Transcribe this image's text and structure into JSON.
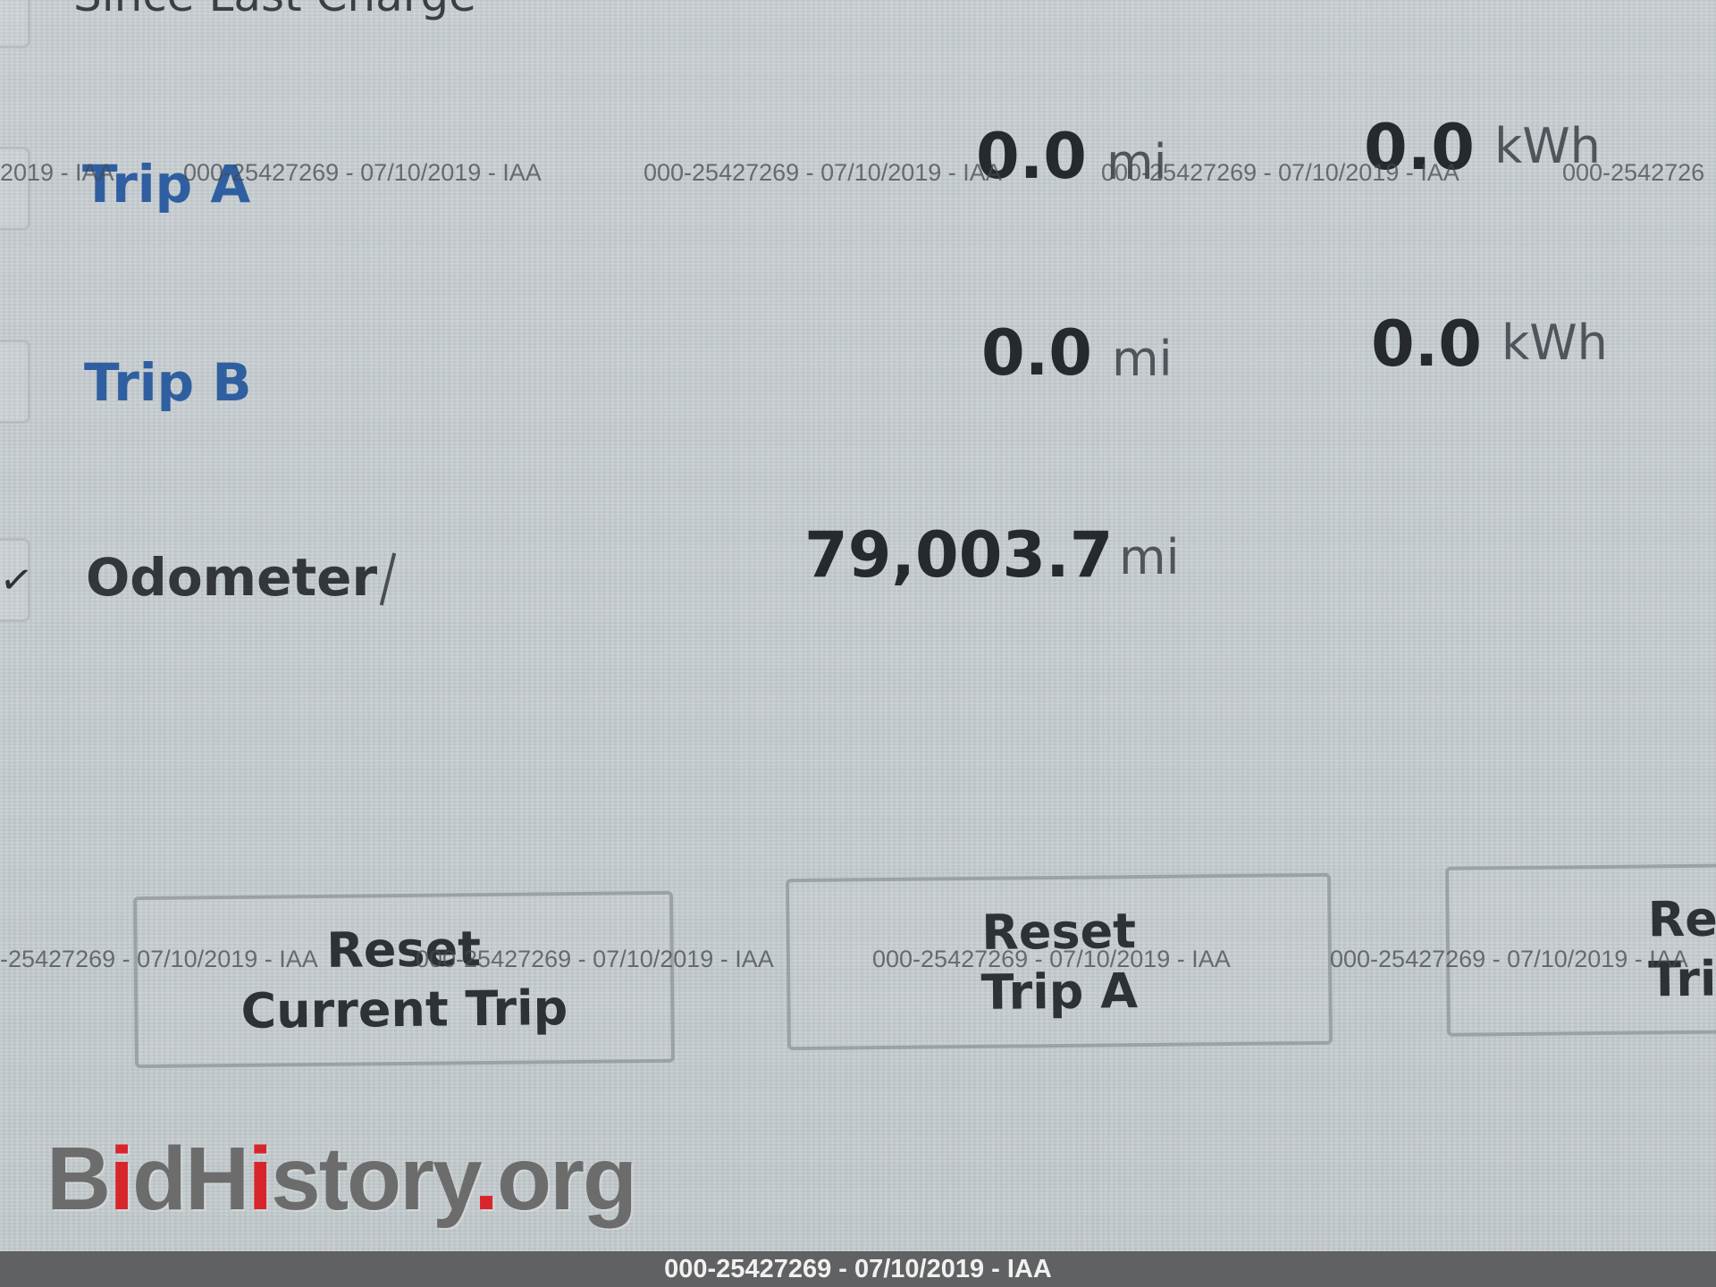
{
  "section": {
    "heading": "Since Last Charge"
  },
  "trips": [
    {
      "label": "Trip A",
      "distance": "0.0",
      "distance_unit": "mi",
      "energy": "0.0",
      "energy_unit": "kWh"
    },
    {
      "label": "Trip B",
      "distance": "0.0",
      "distance_unit": "mi",
      "energy": "0.0",
      "energy_unit": "kWh"
    }
  ],
  "odometer": {
    "label": "Odometer",
    "value": "79,003.7",
    "unit": "mi"
  },
  "buttons": {
    "reset_current_line1": "Reset",
    "reset_current_line2": "Current Trip",
    "reset_a_line1": "Reset",
    "reset_a_line2": "Trip A",
    "reset_b_line1": "Re",
    "reset_b_line2": "Tri"
  },
  "watermark": {
    "text": "000-25427269 - 07/10/2019 - IAA",
    "left_fragment_row1": "2019 - IAA",
    "left_fragment_row2": "-25427269 - 07/10/2019 - IAA",
    "right_fragment_row1": "000-2542726"
  },
  "logo": {
    "part1": "B",
    "part2": "i",
    "part3": "dH",
    "part4": "i",
    "part5": "story",
    "part6": ".",
    "part7": "org"
  },
  "footer": {
    "text": "000-25427269 - 07/10/2019 - IAA"
  },
  "colors": {
    "trip_label": "#2f5fa0",
    "value_text": "#26292d",
    "logo_red": "#d8252b",
    "logo_gray": "#6c6c6c"
  }
}
